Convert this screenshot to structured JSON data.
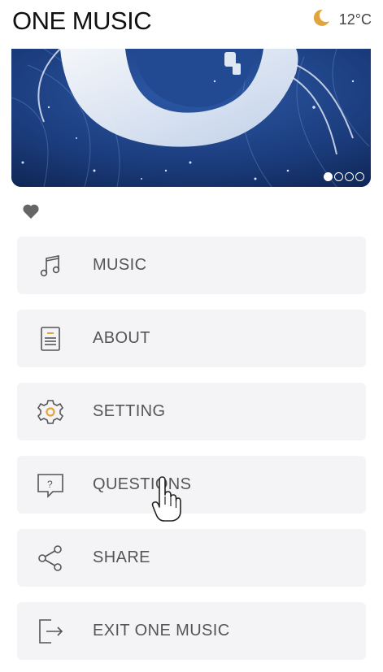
{
  "header": {
    "title": "ONE MUSIC",
    "weather_icon": "moon-icon",
    "temperature": "12°C"
  },
  "banner": {
    "image": "illustration of a white moon-whale swirling through a starry blue sky",
    "slides": 4,
    "active_slide": 1
  },
  "like": {
    "icon": "heart-icon"
  },
  "menu": {
    "items": [
      {
        "label": "MUSIC",
        "icon": "music-note-icon"
      },
      {
        "label": "ABOUT",
        "icon": "document-icon"
      },
      {
        "label": "SETTING",
        "icon": "gear-icon"
      },
      {
        "label": "QUESTIONS",
        "icon": "question-bubble-icon"
      },
      {
        "label": "SHARE",
        "icon": "share-icon"
      },
      {
        "label": "EXIT ONE MUSIC",
        "icon": "exit-icon"
      }
    ]
  },
  "colors": {
    "accent": "#e0a53c",
    "item_bg": "#f4f4f6",
    "text": "#555555",
    "banner_sky": "#1a3a73"
  }
}
